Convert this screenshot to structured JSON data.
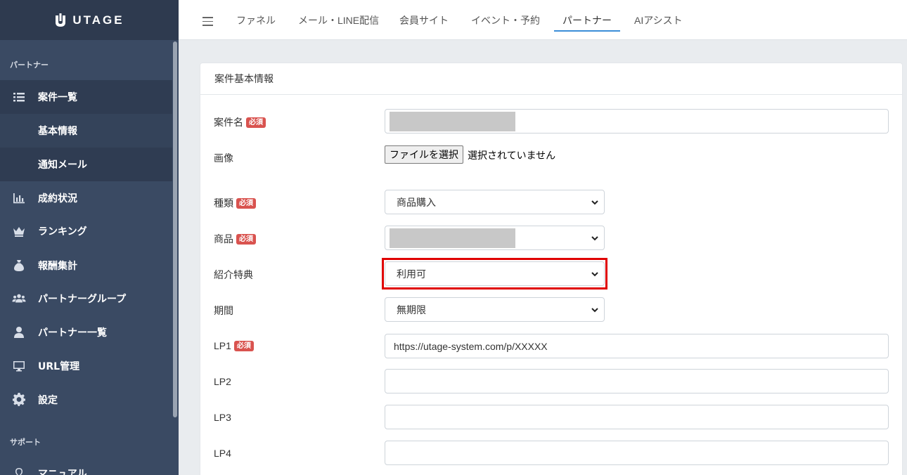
{
  "brand": {
    "name": "UTAGE"
  },
  "sidebar": {
    "section_partner": "パートナー",
    "section_support": "サポート",
    "items": [
      {
        "label": "案件一覧",
        "icon": "list-icon"
      },
      {
        "label": "基本情報"
      },
      {
        "label": "通知メール"
      },
      {
        "label": "成約状況",
        "icon": "bar-chart-icon"
      },
      {
        "label": "ランキング",
        "icon": "crown-icon"
      },
      {
        "label": "報酬集計",
        "icon": "money-bag-icon"
      },
      {
        "label": "パートナーグループ",
        "icon": "users-icon"
      },
      {
        "label": "パートナー一覧",
        "icon": "user-icon"
      },
      {
        "label": "URL管理",
        "icon": "desktop-icon"
      },
      {
        "label": "設定",
        "icon": "gear-icon"
      },
      {
        "label": "マニュアル",
        "icon": "bulb-icon"
      }
    ]
  },
  "topnav": {
    "tabs": [
      {
        "label": "ファネル"
      },
      {
        "label": "メール・LINE配信"
      },
      {
        "label": "会員サイト"
      },
      {
        "label": "イベント・予約"
      },
      {
        "label": "パートナー"
      },
      {
        "label": "AIアシスト"
      }
    ],
    "active_tab": "パートナー"
  },
  "form": {
    "header": "案件基本情報",
    "required_badge": "必須",
    "name_label": "案件名",
    "image_label": "画像",
    "file_button": "ファイルを選択",
    "file_status": "選択されていません",
    "type_label": "種類",
    "type_value": "商品購入",
    "product_label": "商品",
    "benefit_label": "紹介特典",
    "benefit_value": "利用可",
    "period_label": "期間",
    "period_value": "無期限",
    "lp1_label": "LP1",
    "lp1_value": "https://utage-system.com/p/XXXXX",
    "lp2_label": "LP2",
    "lp3_label": "LP3",
    "lp4_label": "LP4"
  },
  "colors": {
    "sidebar_bg": "#3a4a63",
    "accent": "#3b8ed8",
    "required": "#d9534f",
    "highlight": "#e00000"
  }
}
